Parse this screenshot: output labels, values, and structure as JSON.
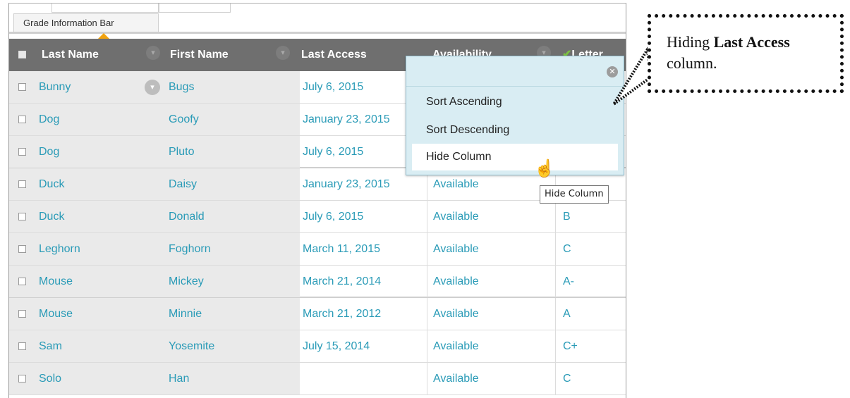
{
  "info_bar": {
    "label": "Grade Information Bar"
  },
  "columns": {
    "last_name": "Last Name",
    "first_name": "First Name",
    "last_access": "Last Access",
    "availability": "Availability",
    "letter": "Letter"
  },
  "rows": [
    {
      "last": "Bunny",
      "first": "Bugs",
      "access": "July 6, 2015",
      "avail": "",
      "grade": ""
    },
    {
      "last": "Dog",
      "first": "Goofy",
      "access": "January 23, 2015",
      "avail": "",
      "grade": ""
    },
    {
      "last": "Dog",
      "first": "Pluto",
      "access": "July 6, 2015",
      "avail": "",
      "grade": ""
    },
    {
      "last": "Duck",
      "first": "Daisy",
      "access": "January 23, 2015",
      "avail": "Available",
      "grade": ""
    },
    {
      "last": "Duck",
      "first": "Donald",
      "access": "July 6, 2015",
      "avail": "Available",
      "grade": "B"
    },
    {
      "last": "Leghorn",
      "first": "Foghorn",
      "access": "March 11, 2015",
      "avail": "Available",
      "grade": "C"
    },
    {
      "last": "Mouse",
      "first": "Mickey",
      "access": "March 21, 2014",
      "avail": "Available",
      "grade": "A-"
    },
    {
      "last": "Mouse",
      "first": "Minnie",
      "access": "March 21, 2012",
      "avail": "Available",
      "grade": "A"
    },
    {
      "last": "Sam",
      "first": "Yosemite",
      "access": "July 15, 2014",
      "avail": "Available",
      "grade": "C+"
    },
    {
      "last": "Solo",
      "first": "Han",
      "access": "",
      "avail": "Available",
      "grade": "C"
    }
  ],
  "menu": {
    "items": [
      "Sort Ascending",
      "Sort Descending",
      "Hide Column"
    ],
    "hovered": "Hide Column"
  },
  "tooltip": "Hide Column",
  "callout": {
    "pre": "Hiding ",
    "bold": "Last Access",
    "post": " column."
  },
  "icons": {
    "sort": "sort-ascending-indicator",
    "chevron": "chevron-down-icon",
    "close": "close-icon",
    "check": "check-icon",
    "cursor": "hand-pointer-icon"
  },
  "colors": {
    "link": "#2a9bb7",
    "header": "#6f6f6f",
    "menu_bg": "#d9edf3",
    "sort_arrow": "#f2a30f"
  }
}
